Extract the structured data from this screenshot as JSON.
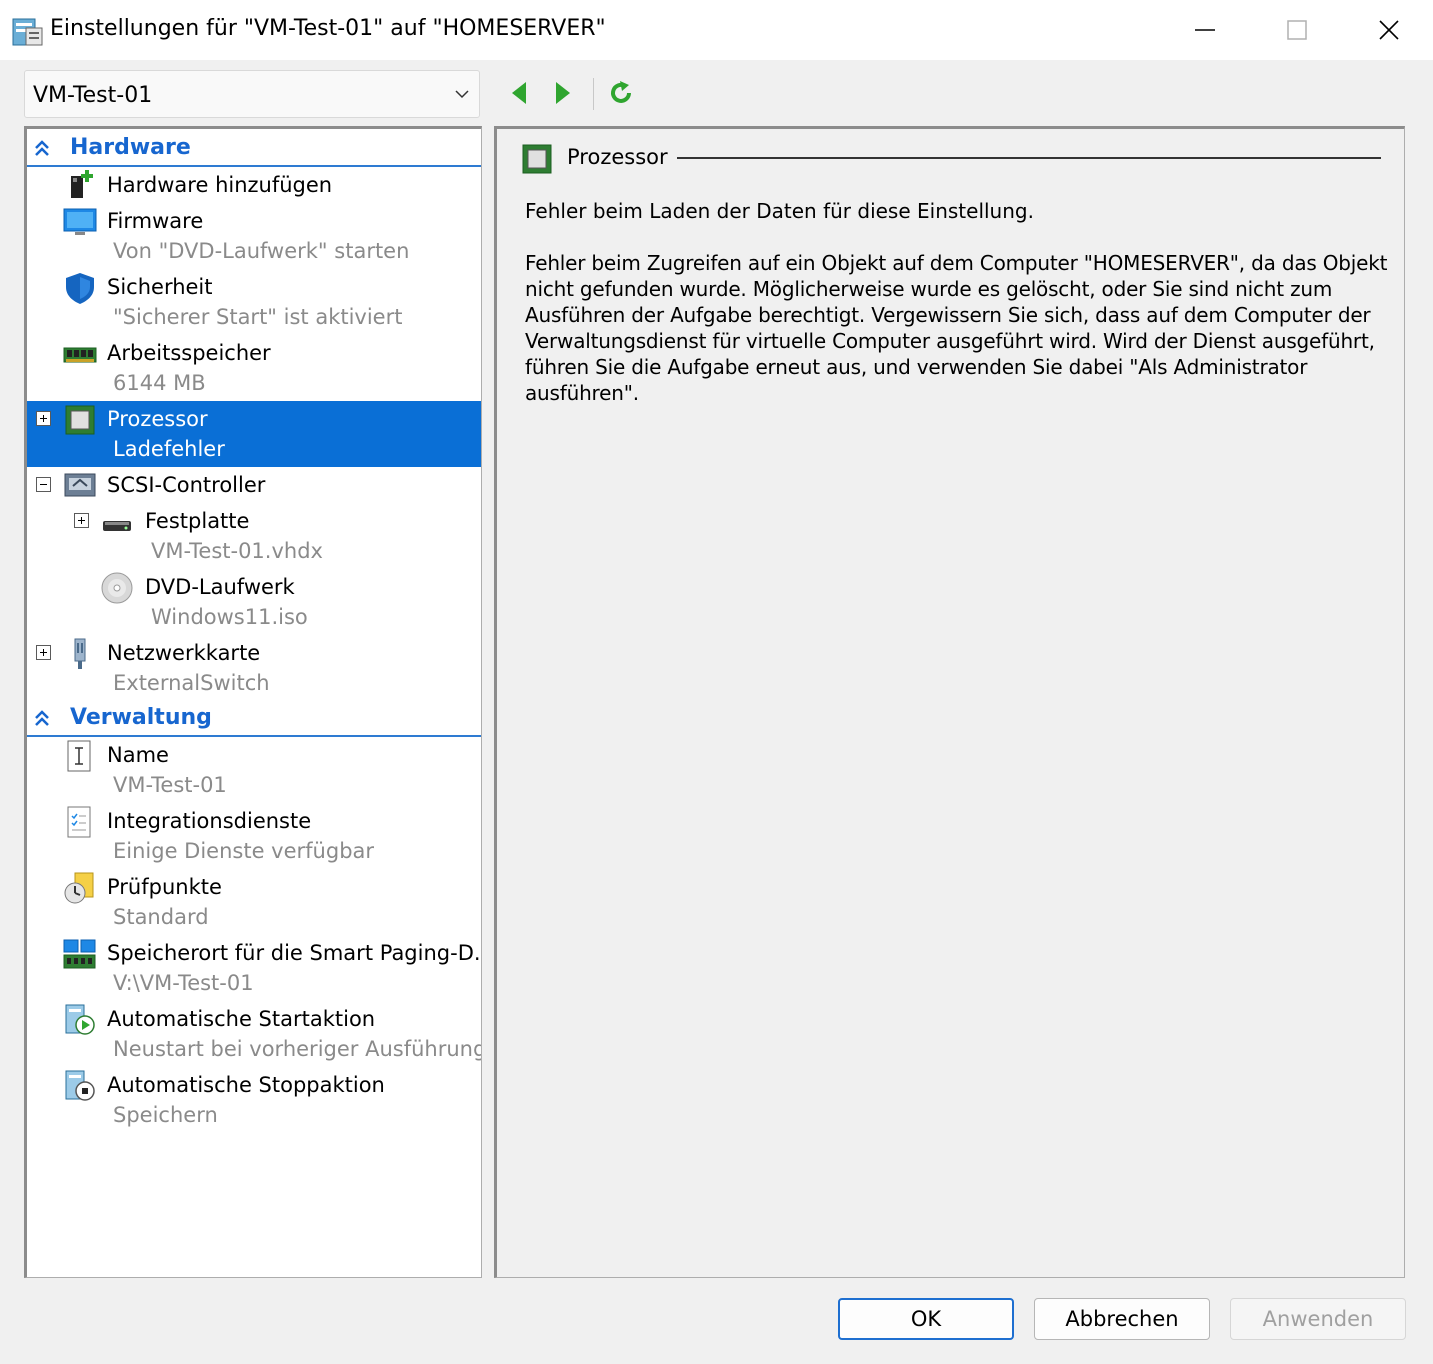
{
  "window": {
    "title": "Einstellungen für \"VM-Test-01\" auf \"HOMESERVER\""
  },
  "toolbar": {
    "vm_selected": "VM-Test-01"
  },
  "tree": {
    "hardware_label": "Hardware",
    "management_label": "Verwaltung",
    "hardware_items": [
      {
        "label": "Hardware hinzufügen",
        "sub": ""
      },
      {
        "label": "Firmware",
        "sub": "Von \"DVD-Laufwerk\" starten"
      },
      {
        "label": "Sicherheit",
        "sub": "\"Sicherer Start\" ist aktiviert"
      },
      {
        "label": "Arbeitsspeicher",
        "sub": "6144 MB"
      },
      {
        "label": "Prozessor",
        "sub": "Ladefehler"
      },
      {
        "label": "SCSI-Controller",
        "sub": ""
      },
      {
        "label": "Festplatte",
        "sub": "VM-Test-01.vhdx"
      },
      {
        "label": "DVD-Laufwerk",
        "sub": "Windows11.iso"
      },
      {
        "label": "Netzwerkkarte",
        "sub": "ExternalSwitch"
      }
    ],
    "management_items": [
      {
        "label": "Name",
        "sub": "VM-Test-01"
      },
      {
        "label": "Integrationsdienste",
        "sub": "Einige Dienste verfügbar"
      },
      {
        "label": "Prüfpunkte",
        "sub": "Standard"
      },
      {
        "label": "Speicherort für die Smart Paging-D...",
        "sub": "V:\\VM-Test-01"
      },
      {
        "label": "Automatische Startaktion",
        "sub": "Neustart bei vorheriger Ausführung"
      },
      {
        "label": "Automatische Stoppaktion",
        "sub": "Speichern"
      }
    ]
  },
  "detail": {
    "title": "Prozessor",
    "error_heading": "Fehler beim Laden der Daten für diese Einstellung.",
    "error_lines": [
      "Fehler beim Zugreifen auf ein Objekt auf dem Computer \"HOMESERVER\", da das Objekt",
      "nicht gefunden wurde. Möglicherweise wurde es gelöscht, oder Sie sind nicht zum",
      "Ausführen der Aufgabe berechtigt. Vergewissern Sie sich, dass auf dem Computer der",
      "Verwaltungsdienst für virtuelle Computer ausgeführt wird. Wird der Dienst ausgeführt,",
      "führen Sie die Aufgabe erneut aus, und verwenden Sie dabei \"Als Administrator",
      "ausführen\"."
    ]
  },
  "buttons": {
    "ok": "OK",
    "cancel": "Abbrechen",
    "apply": "Anwenden"
  },
  "colors": {
    "selection": "#0a6fd6",
    "category": "#1766cf",
    "nav_arrow": "#2fa52f"
  },
  "icons": [
    "app-settings-icon",
    "minimize-icon",
    "maximize-icon",
    "close-icon",
    "chevron-down-icon",
    "back-arrow-icon",
    "forward-arrow-icon",
    "refresh-icon",
    "add-hardware-icon",
    "firmware-icon",
    "shield-icon",
    "memory-icon",
    "processor-icon",
    "scsi-icon",
    "hard-disk-icon",
    "dvd-icon",
    "network-adapter-icon",
    "name-icon",
    "integration-services-icon",
    "checkpoint-icon",
    "smart-paging-icon",
    "start-action-icon",
    "stop-action-icon"
  ]
}
